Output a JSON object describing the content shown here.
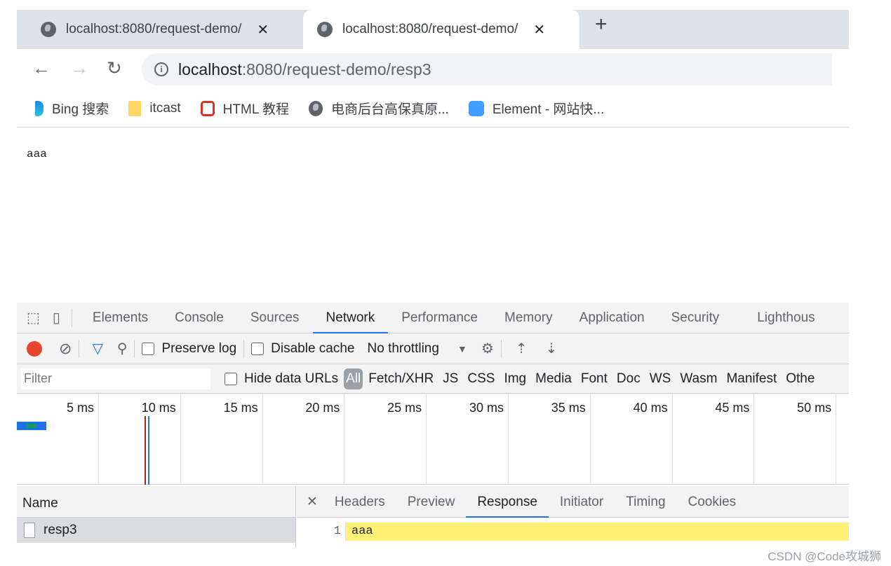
{
  "browser": {
    "tabs": [
      {
        "title": "localhost:8080/request-demo/",
        "active": false
      },
      {
        "title": "localhost:8080/request-demo/",
        "active": true
      }
    ],
    "new_tab": "+",
    "close": "✕",
    "url_host": "localhost",
    "url_rest": ":8080/request-demo/resp3",
    "bookmarks": [
      {
        "label": "Bing 搜索",
        "icon": "bing-icon"
      },
      {
        "label": "itcast",
        "icon": "folder-icon"
      },
      {
        "label": "HTML 教程",
        "icon": "runoob-icon"
      },
      {
        "label": "电商后台高保真原...",
        "icon": "globe-icon"
      },
      {
        "label": "Element - 网站快...",
        "icon": "element-icon"
      }
    ]
  },
  "page": {
    "body_text": "aaa"
  },
  "devtools": {
    "tabs": [
      "Elements",
      "Console",
      "Sources",
      "Network",
      "Performance",
      "Memory",
      "Application",
      "Security",
      "Lighthous"
    ],
    "active_tab": "Network",
    "toolbar": {
      "preserve_log": "Preserve log",
      "disable_cache": "Disable cache",
      "throttling": "No throttling"
    },
    "filter": {
      "placeholder": "Filter",
      "hide_data_urls": "Hide data URLs",
      "all": "All",
      "types": [
        "Fetch/XHR",
        "JS",
        "CSS",
        "Img",
        "Media",
        "Font",
        "Doc",
        "WS",
        "Wasm",
        "Manifest",
        "Othe"
      ]
    },
    "timeline_ticks": [
      "5 ms",
      "10 ms",
      "15 ms",
      "20 ms",
      "25 ms",
      "30 ms",
      "35 ms",
      "40 ms",
      "45 ms",
      "50 ms"
    ],
    "name_header": "Name",
    "requests": [
      {
        "name": "resp3"
      }
    ],
    "detail_tabs": [
      "Headers",
      "Preview",
      "Response",
      "Initiator",
      "Timing",
      "Cookies"
    ],
    "detail_active": "Response",
    "response": {
      "line": "1",
      "text": "aaa"
    }
  },
  "colors": {
    "record": "#e8432e",
    "accent": "#1a73e8",
    "highlight": "#fff176"
  },
  "watermark": "CSDN @Code攻城狮"
}
